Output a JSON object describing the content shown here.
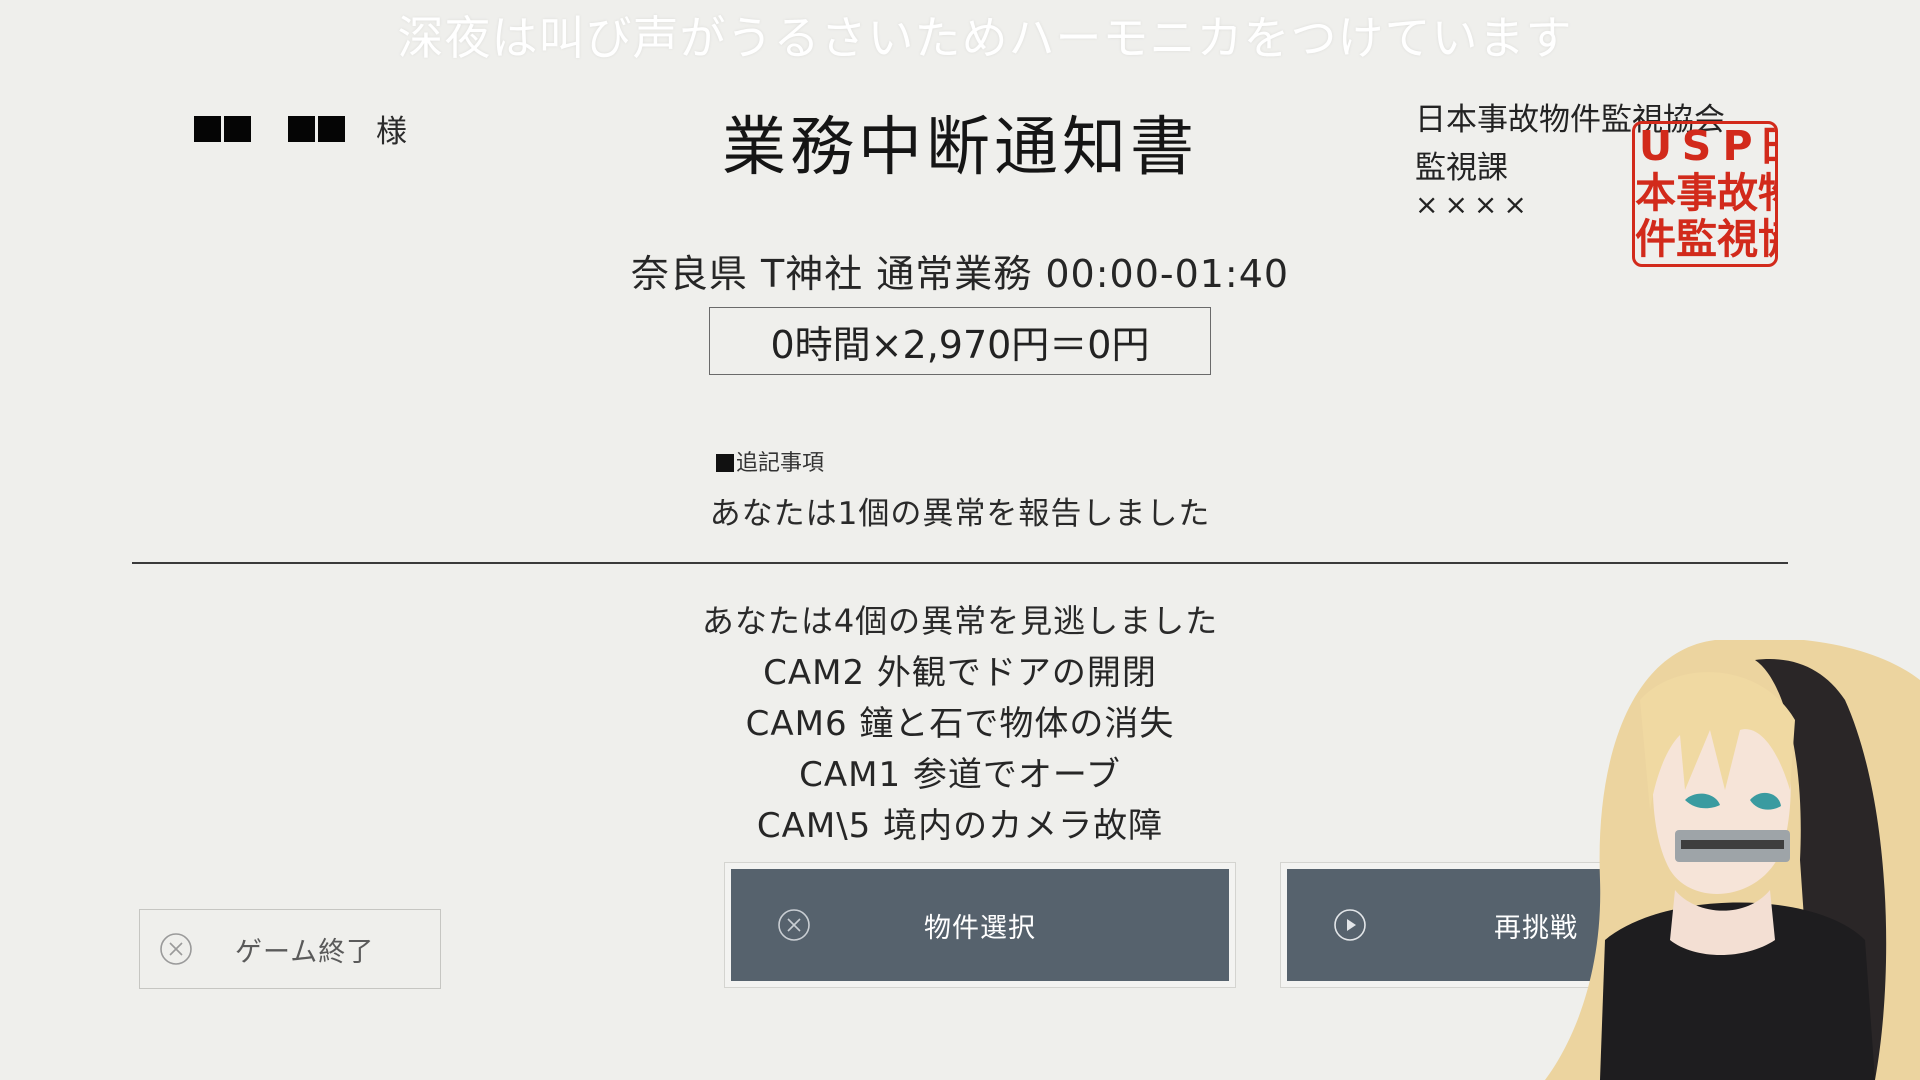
{
  "overlay_caption": "深夜は叫び声がうるさいためハーモニカをつけています",
  "recipient": {
    "honorific": "様"
  },
  "document": {
    "title": "業務中断通知書",
    "job_line": "奈良県 T神社 通常業務 00:00-01:40",
    "pay_calculation": "0時間×2,970円＝0円"
  },
  "issuer": {
    "association": "日本事故物件監視協会",
    "department": "監視課",
    "signer": "××××",
    "seal_text": "USP日本事故物件監視協会"
  },
  "notes": {
    "heading": "追記事項",
    "reported": "あなたは1個の異常を報告しました"
  },
  "missed": {
    "summary": "あなたは4個の異常を見逃しました",
    "items": [
      "CAM2 外観でドアの開閉",
      "CAM6 鐘と石で物体の消失",
      "CAM1 参道でオーブ",
      "CAM\\5 境内のカメラ故障"
    ]
  },
  "buttons": {
    "quit": "ゲーム終了",
    "property_select": "物件選択",
    "retry": "再挑戦"
  },
  "colors": {
    "background": "#efefec",
    "button_dark": "#56626d",
    "seal_red": "#d22a1b"
  },
  "icons": {
    "quit": "close-circle-icon",
    "property_select": "close-circle-icon",
    "retry": "play-circle-icon"
  }
}
